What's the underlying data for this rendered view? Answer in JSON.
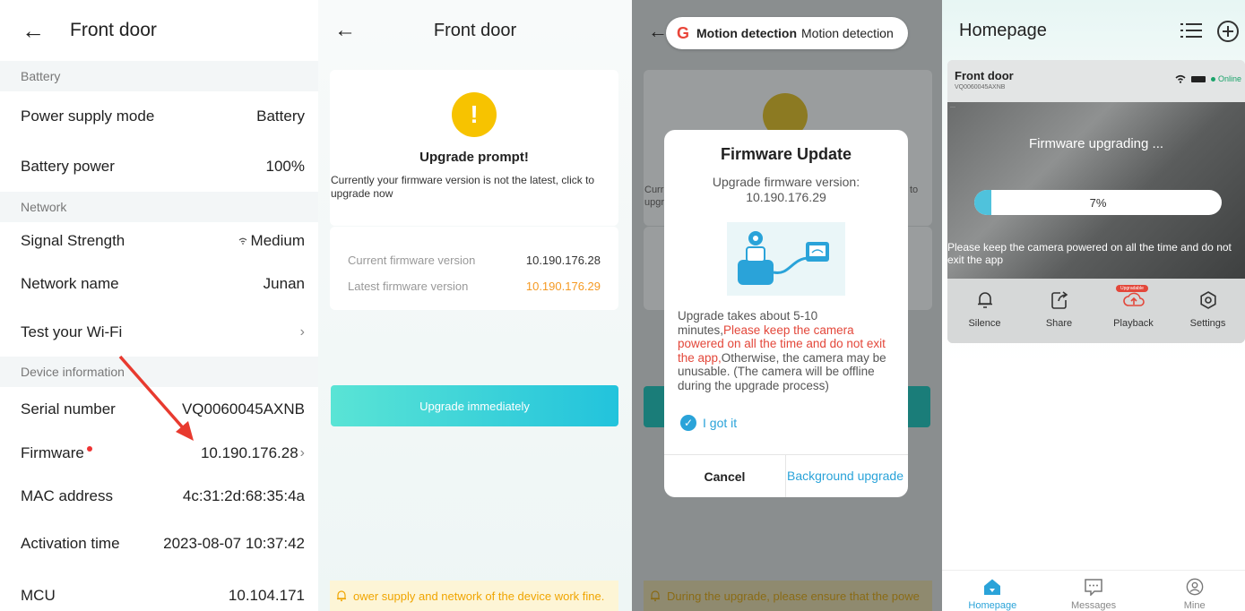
{
  "panel1": {
    "title": "Front door",
    "sections": {
      "battery": "Battery",
      "network": "Network",
      "device_info": "Device information"
    },
    "rows": {
      "power_supply_mode": {
        "label": "Power supply mode",
        "value": "Battery"
      },
      "battery_power": {
        "label": "Battery power",
        "value": "100%"
      },
      "signal_strength": {
        "label": "Signal Strength",
        "value": "Medium"
      },
      "network_name": {
        "label": "Network name",
        "value": "Junan"
      },
      "test_wifi": {
        "label": "Test your Wi-Fi"
      },
      "serial_number": {
        "label": "Serial number",
        "value": "VQ0060045AXNB"
      },
      "firmware": {
        "label": "Firmware",
        "value": "10.190.176.28"
      },
      "mac_address": {
        "label": "MAC address",
        "value": "4c:31:2d:68:35:4a"
      },
      "activation_time": {
        "label": "Activation time",
        "value": "2023-08-07 10:37:42"
      },
      "mcu": {
        "label": "MCU",
        "value": "10.104.171"
      }
    }
  },
  "panel2": {
    "title": "Front door",
    "prompt_title": "Upgrade prompt!",
    "prompt_text": "Currently your firmware version is not the latest, click to upgrade now",
    "current_label": "Current firmware version",
    "current_value": "10.190.176.28",
    "latest_label": "Latest firmware version",
    "latest_value": "10.190.176.29",
    "upgrade_button": "Upgrade immediately",
    "notice": "ower supply and network of the device work fine."
  },
  "panel3": {
    "chip_bold": "Motion detection",
    "chip_text": "Motion detection",
    "bg_snippets": {
      "left1": "Curr",
      "left2": "upgr",
      "right1": "to"
    },
    "bg_notice": "During the upgrade, please ensure that the powe",
    "dialog": {
      "title": "Firmware Update",
      "subtitle_line1": "Upgrade firmware version:",
      "subtitle_line2": "10.190.176.29",
      "body_start": "Upgrade takes about 5-10 minutes,",
      "body_red": "Please keep the camera powered on all the time and do not exit the app,",
      "body_end": "Otherwise, the camera may be unusable. (The camera will be offline during the upgrade process)",
      "got_it": "I got it",
      "cancel": "Cancel",
      "background_upgrade": "Background upgrade"
    }
  },
  "panel4": {
    "title": "Homepage",
    "camera_name": "Front door",
    "camera_sn": "VQ0060045AXNB",
    "status": "Online",
    "upgrading_text": "Firmware upgrading ...",
    "progress_label": "7%",
    "progress_fraction": 0.07,
    "keep_text": "Please keep the camera powered on all the time and do not exit the app",
    "actions": {
      "silence": "Silence",
      "share": "Share",
      "playback": "Playback",
      "settings": "Settings"
    },
    "upgradable_badge": "Upgradable",
    "tabs": {
      "homepage": "Homepage",
      "messages": "Messages",
      "mine": "Mine"
    }
  },
  "colors": {
    "accent_blue": "#2aa3d9",
    "warning_yellow": "#f7c300",
    "alert_red": "#e3473a",
    "orange_version": "#f59a23",
    "online_green": "#1aa36a"
  }
}
